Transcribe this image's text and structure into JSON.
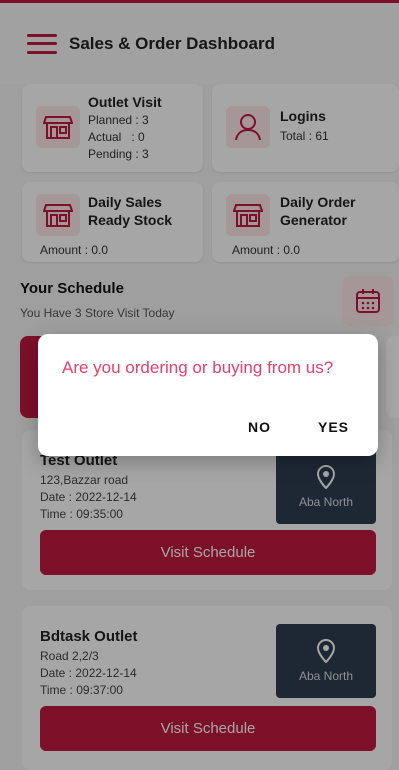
{
  "header": {
    "title": "Sales & Order Dashboard",
    "menu_icon": "hamburger-icon"
  },
  "colors": {
    "brand": "#c0193f",
    "dialog_text": "#e5406a",
    "card_icon_bg": "#fde8ea"
  },
  "cards": {
    "outlet_visit": {
      "title": "Outlet Visit",
      "planned": "Planned : 3",
      "actual": "Actual   : 0",
      "pending": "Pending : 3",
      "icon": "store-icon"
    },
    "logins": {
      "title": "Logins",
      "total": "Total : 61",
      "icon": "user-icon"
    },
    "daily_sales": {
      "title_line1": "Daily Sales",
      "title_line2": "Ready Stock",
      "amount": "Amount : 0.0",
      "icon": "store-icon"
    },
    "daily_order": {
      "title_line1": "Daily Order",
      "title_line2": "Generator",
      "amount": "Amount : 0.0",
      "icon": "store-icon"
    }
  },
  "schedule": {
    "heading": "Your Schedule",
    "subtitle": "You Have 3 Store Visit Today",
    "calendar_icon": "calendar-icon",
    "visits": [
      {
        "name": "Test Outlet",
        "address": "123,Bazzar road",
        "date": "Date : 2022-12-14",
        "time": "Time : 09:35:00",
        "map_label": "Aba North",
        "button": "Visit Schedule"
      },
      {
        "name": "Bdtask Outlet",
        "address": "Road 2,2/3",
        "date": "Date : 2022-12-14",
        "time": "Time : 09:37:00",
        "map_label": "Aba North",
        "button": "Visit Schedule"
      }
    ]
  },
  "dialog": {
    "message": "Are you ordering or buying from us?",
    "no_label": "NO",
    "yes_label": "YES"
  }
}
